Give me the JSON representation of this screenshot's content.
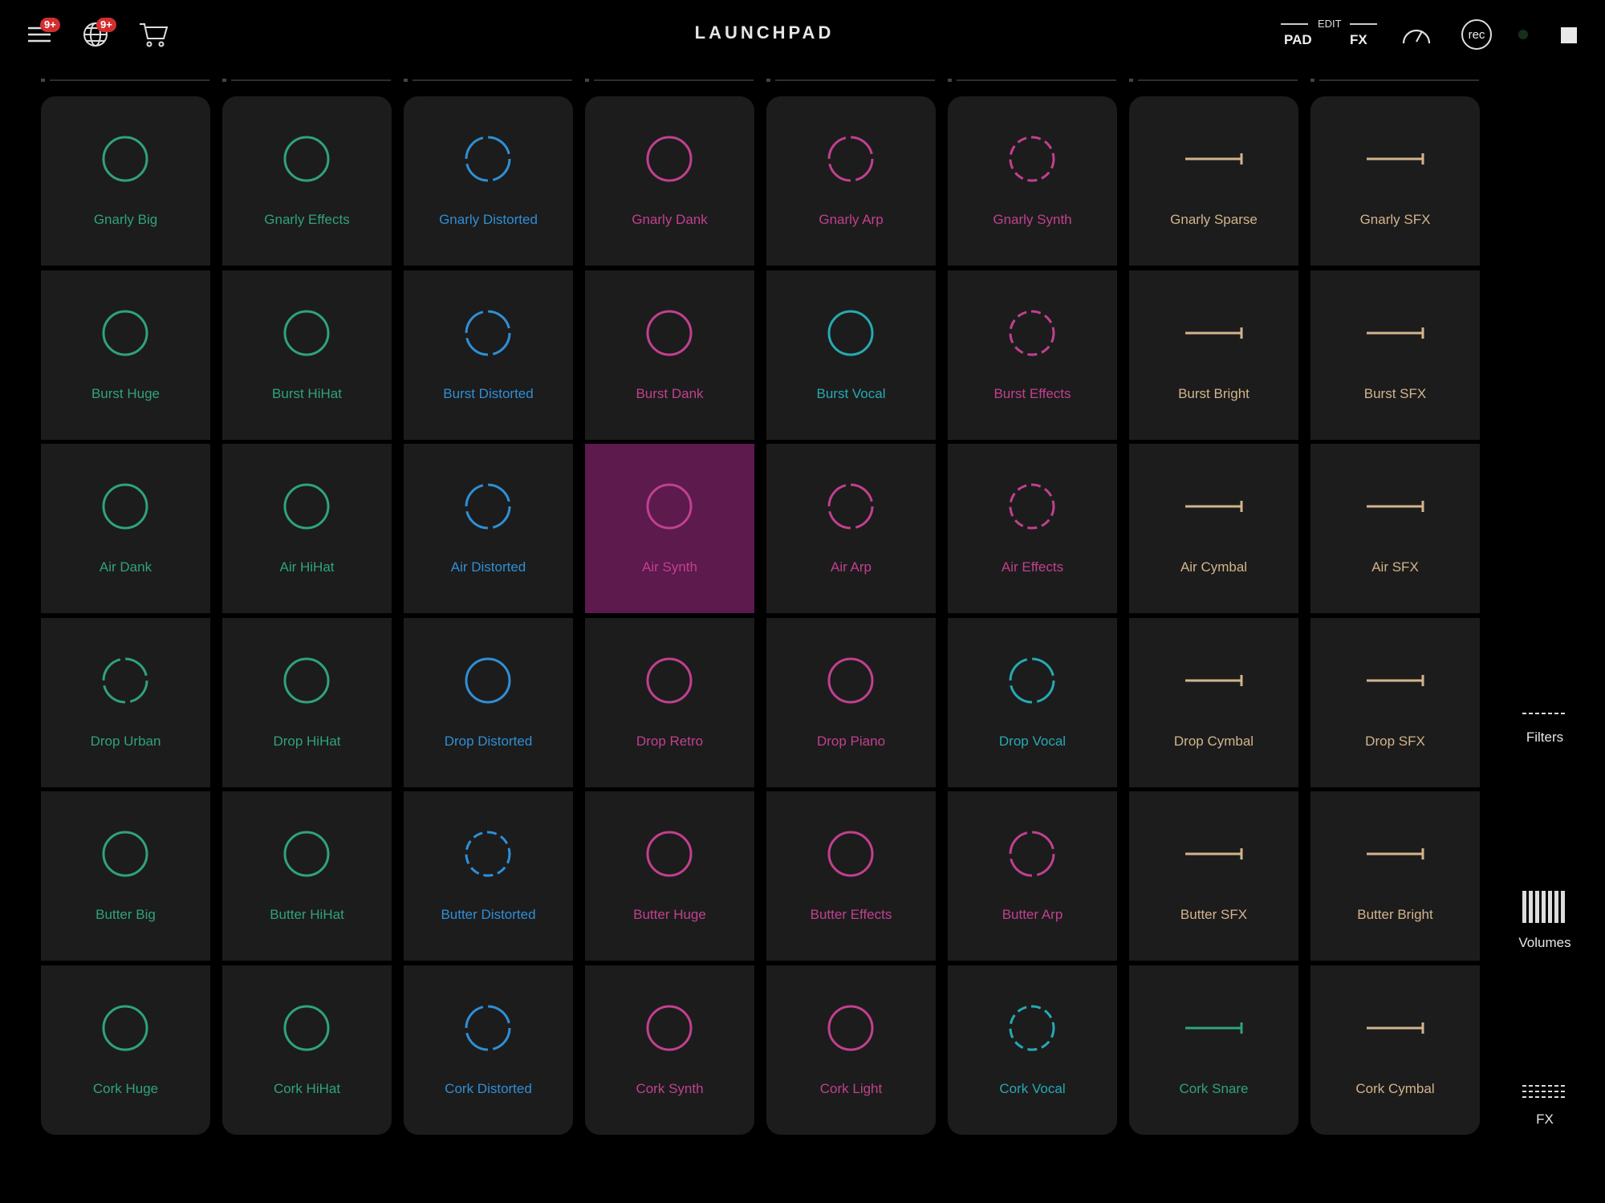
{
  "header": {
    "title": "LAUNCHPAD",
    "menu_badge": "9+",
    "globe_badge": "9+",
    "edit_label": "EDIT",
    "pad_label": "PAD",
    "fx_label": "FX",
    "rec_label": "rec"
  },
  "colors": {
    "green": "#2fa27e",
    "blue": "#2f8fd6",
    "pink": "#c1408f",
    "teal": "#27a9b3",
    "tan": "#d2b48c",
    "active_pad": "#5c1a4d",
    "pad_bg": "#1c1c1c"
  },
  "pads": [
    [
      {
        "label": "Gnarly Big",
        "color": "green",
        "icon": "circle-solid"
      },
      {
        "label": "Gnarly Effects",
        "color": "green",
        "icon": "circle-solid"
      },
      {
        "label": "Gnarly Distorted",
        "color": "blue",
        "icon": "circle-dashed"
      },
      {
        "label": "Gnarly Dank",
        "color": "pink",
        "icon": "circle-solid"
      },
      {
        "label": "Gnarly Arp",
        "color": "pink",
        "icon": "circle-dashed"
      },
      {
        "label": "Gnarly Synth",
        "color": "pink",
        "icon": "circle-dashed-fine"
      },
      {
        "label": "Gnarly Sparse",
        "color": "tan",
        "icon": "line-end"
      },
      {
        "label": "Gnarly SFX",
        "color": "tan",
        "icon": "line-end"
      }
    ],
    [
      {
        "label": "Burst Huge",
        "color": "green",
        "icon": "circle-solid"
      },
      {
        "label": "Burst HiHat",
        "color": "green",
        "icon": "circle-solid"
      },
      {
        "label": "Burst Distorted",
        "color": "blue",
        "icon": "circle-dashed"
      },
      {
        "label": "Burst Dank",
        "color": "pink",
        "icon": "circle-solid"
      },
      {
        "label": "Burst Vocal",
        "color": "teal",
        "icon": "circle-solid"
      },
      {
        "label": "Burst Effects",
        "color": "pink",
        "icon": "circle-dashed-fine"
      },
      {
        "label": "Burst Bright",
        "color": "tan",
        "icon": "line-end"
      },
      {
        "label": "Burst SFX",
        "color": "tan",
        "icon": "line-end"
      }
    ],
    [
      {
        "label": "Air Dank",
        "color": "green",
        "icon": "circle-solid"
      },
      {
        "label": "Air HiHat",
        "color": "green",
        "icon": "circle-solid"
      },
      {
        "label": "Air Distorted",
        "color": "blue",
        "icon": "circle-dashed"
      },
      {
        "label": "Air Synth",
        "color": "pink",
        "icon": "circle-solid",
        "active": true
      },
      {
        "label": "Air Arp",
        "color": "pink",
        "icon": "circle-dashed"
      },
      {
        "label": "Air Effects",
        "color": "pink",
        "icon": "circle-dashed-fine"
      },
      {
        "label": "Air Cymbal",
        "color": "tan",
        "icon": "line-end"
      },
      {
        "label": "Air SFX",
        "color": "tan",
        "icon": "line-end"
      }
    ],
    [
      {
        "label": "Drop Urban",
        "color": "green",
        "icon": "circle-dashed"
      },
      {
        "label": "Drop HiHat",
        "color": "green",
        "icon": "circle-solid"
      },
      {
        "label": "Drop Distorted",
        "color": "blue",
        "icon": "circle-solid"
      },
      {
        "label": "Drop Retro",
        "color": "pink",
        "icon": "circle-solid"
      },
      {
        "label": "Drop Piano",
        "color": "pink",
        "icon": "circle-solid"
      },
      {
        "label": "Drop Vocal",
        "color": "teal",
        "icon": "circle-dashed"
      },
      {
        "label": "Drop Cymbal",
        "color": "tan",
        "icon": "line-end"
      },
      {
        "label": "Drop SFX",
        "color": "tan",
        "icon": "line-end"
      }
    ],
    [
      {
        "label": "Butter Big",
        "color": "green",
        "icon": "circle-solid"
      },
      {
        "label": "Butter HiHat",
        "color": "green",
        "icon": "circle-solid"
      },
      {
        "label": "Butter Distorted",
        "color": "blue",
        "icon": "circle-dashed-fine"
      },
      {
        "label": "Butter Huge",
        "color": "pink",
        "icon": "circle-solid"
      },
      {
        "label": "Butter Effects",
        "color": "pink",
        "icon": "circle-solid"
      },
      {
        "label": "Butter Arp",
        "color": "pink",
        "icon": "circle-dashed"
      },
      {
        "label": "Butter SFX",
        "color": "tan",
        "icon": "line-end"
      },
      {
        "label": "Butter Bright",
        "color": "tan",
        "icon": "line-end"
      }
    ],
    [
      {
        "label": "Cork Huge",
        "color": "green",
        "icon": "circle-solid"
      },
      {
        "label": "Cork HiHat",
        "color": "green",
        "icon": "circle-solid"
      },
      {
        "label": "Cork Distorted",
        "color": "blue",
        "icon": "circle-dashed"
      },
      {
        "label": "Cork Synth",
        "color": "pink",
        "icon": "circle-solid"
      },
      {
        "label": "Cork Light",
        "color": "pink",
        "icon": "circle-solid"
      },
      {
        "label": "Cork Vocal",
        "color": "teal",
        "icon": "circle-dashed-fine"
      },
      {
        "label": "Cork Snare",
        "color": "green",
        "icon": "line-end"
      },
      {
        "label": "Cork Cymbal",
        "color": "tan",
        "icon": "line-end"
      }
    ]
  ],
  "side": {
    "filters_label": "Filters",
    "volumes_label": "Volumes",
    "fx_label": "FX"
  }
}
